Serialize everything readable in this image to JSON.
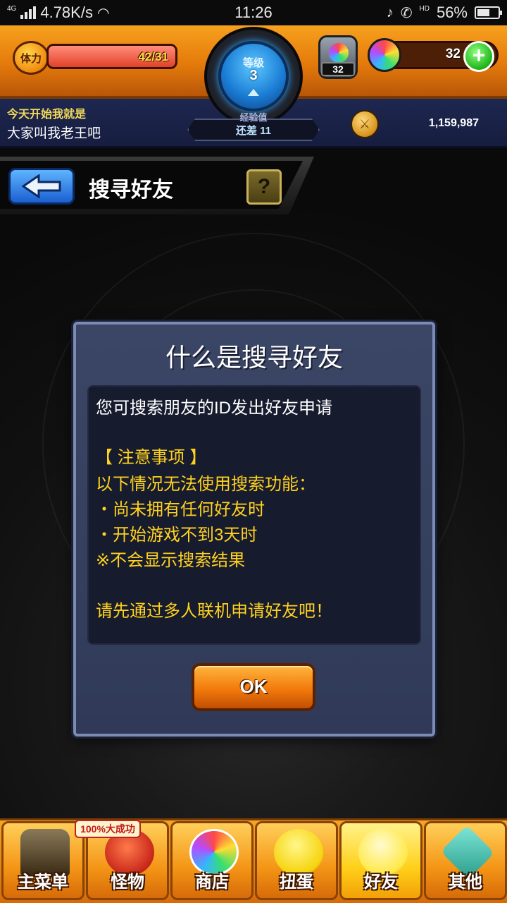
{
  "status_bar": {
    "network": "4G",
    "speed": "4.78K/s",
    "time": "11:26",
    "hd": "HD",
    "battery": "56%"
  },
  "hud": {
    "stamina_label": "体力",
    "stamina": "42/31",
    "level_label": "等级",
    "level": "3",
    "exp_label": "经验值",
    "exp_remaining": "还差 11",
    "egg_count": "32",
    "stone_count": "32",
    "add_label": "+",
    "message_line1": "今天开始我就是",
    "message_line2": "大家叫我老王吧",
    "coins": "1,159,987"
  },
  "page": {
    "title": "搜寻好友",
    "help": "?"
  },
  "dialog": {
    "title": "什么是搜寻好友",
    "intro": "您可搜索朋友的ID发出好友申请",
    "notice_heading": "【 注意事项 】",
    "notice_lead": "以下情况无法使用搜索功能：",
    "item1": "・尚未拥有任何好友时",
    "item2": "・开始游戏不到3天时",
    "item3": "※不会显示搜索结果",
    "closing": "请先通过多人联机申请好友吧！",
    "ok": "OK"
  },
  "nav": {
    "badge": "100%大成功",
    "items": [
      {
        "label": "主菜单"
      },
      {
        "label": "怪物"
      },
      {
        "label": "商店"
      },
      {
        "label": "扭蛋"
      },
      {
        "label": "好友"
      },
      {
        "label": "其他"
      }
    ]
  },
  "colors": {
    "hud_orange": "#f09020",
    "dialog_blue": "#333d5c",
    "highlight_yellow": "#ffd21f",
    "ok_orange": "#f27a0c"
  }
}
